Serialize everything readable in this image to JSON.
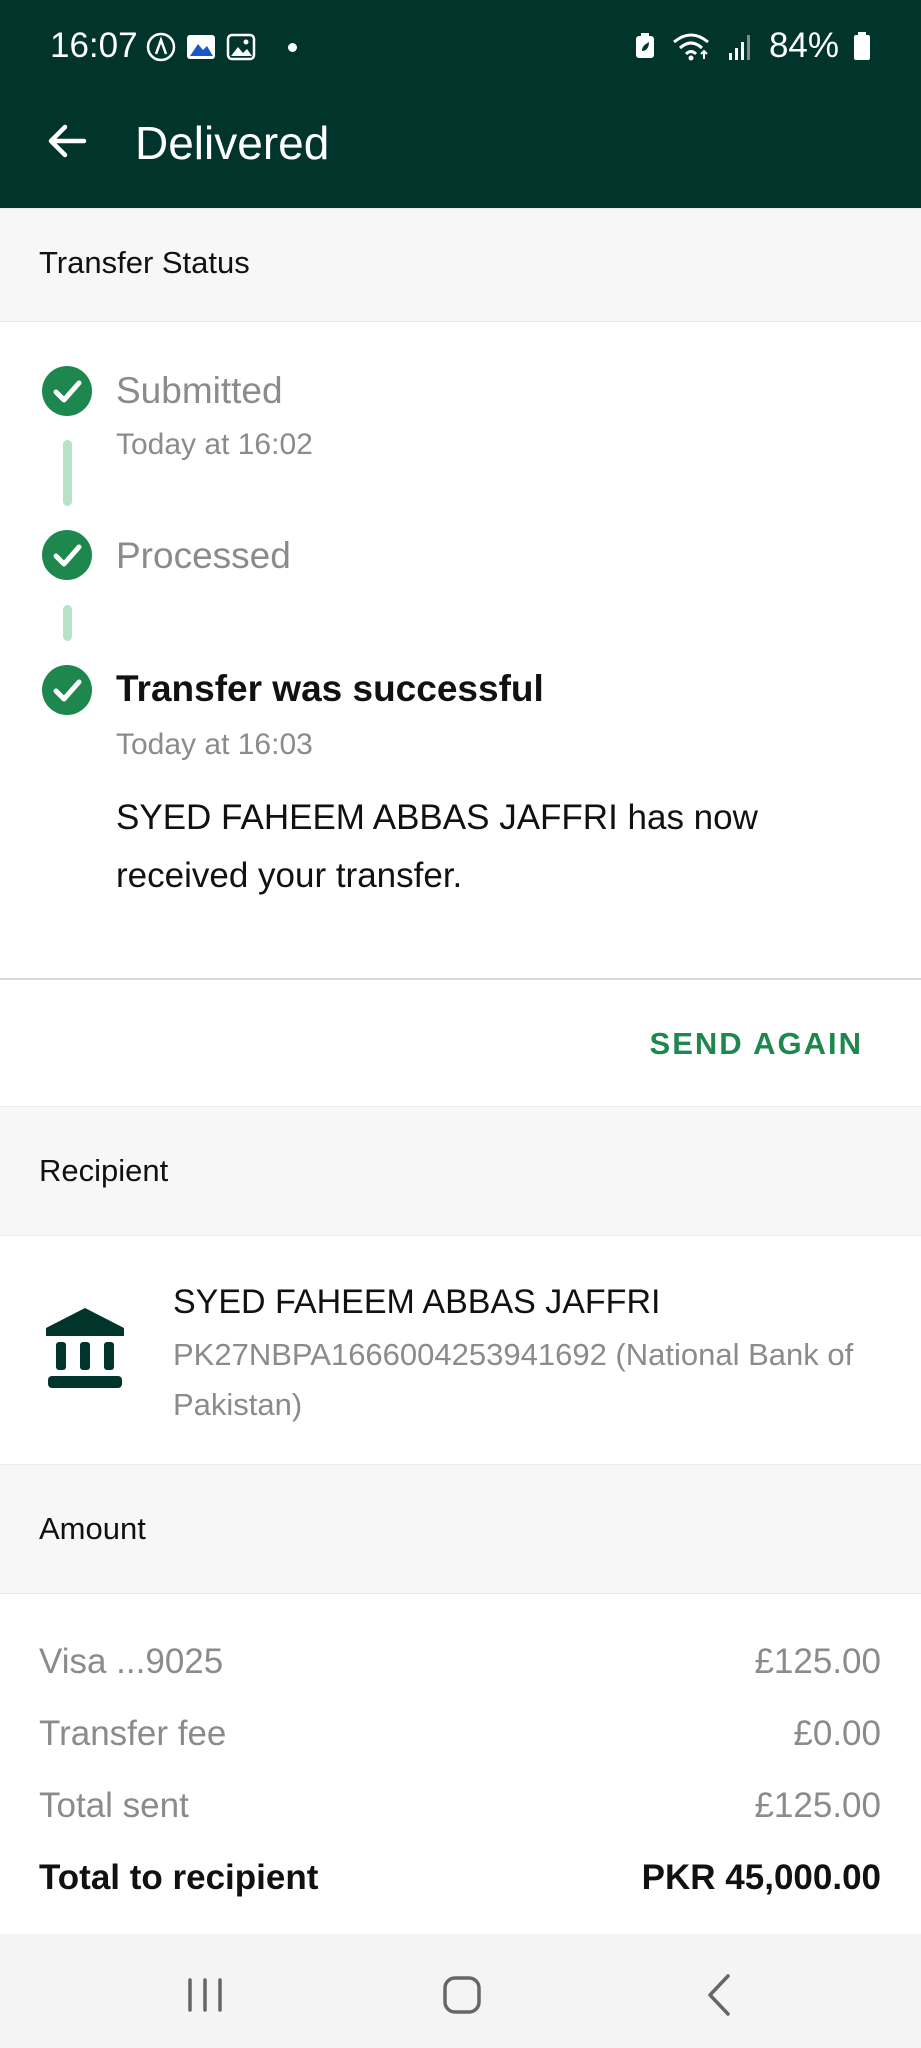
{
  "status_bar": {
    "time": "16:07",
    "battery": "84%"
  },
  "header": {
    "title": "Delivered"
  },
  "transfer_status": {
    "heading": "Transfer Status",
    "steps": [
      {
        "title": "Submitted",
        "subtitle": "Today at 16:02"
      },
      {
        "title": "Processed"
      },
      {
        "title": "Transfer was successful",
        "subtitle": "Today at 16:03",
        "message": "SYED FAHEEM ABBAS JAFFRI has now received your transfer."
      }
    ],
    "send_again_label": "SEND AGAIN"
  },
  "recipient": {
    "heading": "Recipient",
    "name": "SYED FAHEEM ABBAS JAFFRI",
    "account": "PK27NBPA1666004253941692 (National Bank of Pakistan)"
  },
  "amount": {
    "heading": "Amount",
    "rows": [
      {
        "label": "Visa ...9025",
        "value": "£125.00"
      },
      {
        "label": "Transfer fee",
        "value": "£0.00"
      },
      {
        "label": "Total sent",
        "value": "£125.00"
      },
      {
        "label": "Total to recipient",
        "value": "PKR 45,000.00"
      }
    ]
  },
  "colors": {
    "header_bg": "#01342b",
    "accent": "#1d874e",
    "connector": "#b6e3c6"
  }
}
